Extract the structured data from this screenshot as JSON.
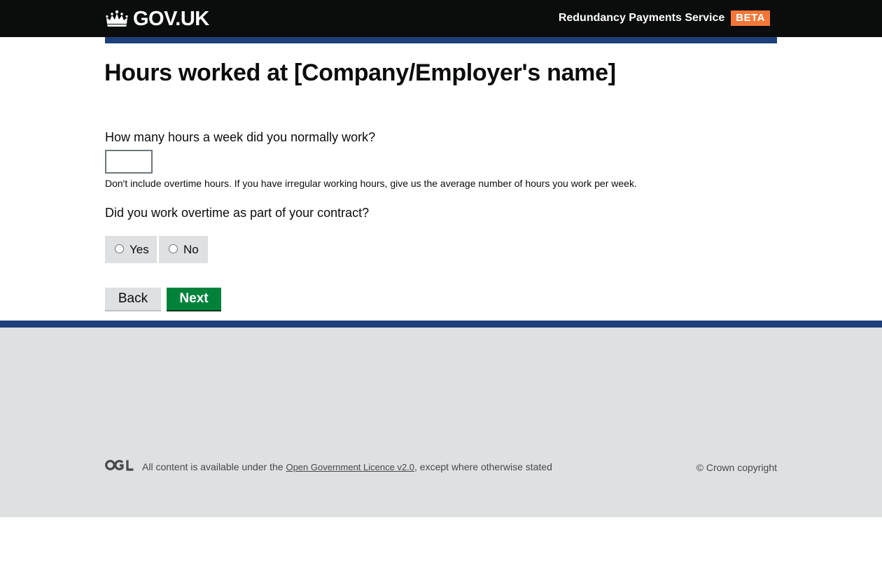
{
  "header": {
    "logo_text": "GOV.UK",
    "logo_icon": "crown-icon",
    "service_name": "Redundancy Payments Service",
    "phase_tag": "BETA",
    "colors": {
      "header_bg": "#0b0c0c",
      "rule": "#1d3f7a",
      "tag": "#f47738"
    }
  },
  "main": {
    "title": "Hours worked at [Company/Employer's name]",
    "hours_question": "How many hours a week did you normally work?",
    "hours_value": "",
    "hours_hint": "Don't include overtime hours. If you have irregular working hours, give us the average number of hours you work per week.",
    "overtime_question": "Did you work overtime as part of your contract?",
    "overtime_options": [
      {
        "label": "Yes",
        "selected": false
      },
      {
        "label": "No",
        "selected": false
      }
    ],
    "back_label": "Back",
    "next_label": "Next",
    "colors": {
      "next_button": "#00823b",
      "back_button": "#dee0e2"
    }
  },
  "footer": {
    "ogl_icon": "ogl-logo-icon",
    "licence_prefix": "All content is available under the ",
    "licence_link": "Open Government Licence v2.0",
    "licence_suffix": ", except where otherwise stated",
    "copyright": "© Crown copyright",
    "colors": {
      "footer_bg": "#dee0e2"
    }
  }
}
